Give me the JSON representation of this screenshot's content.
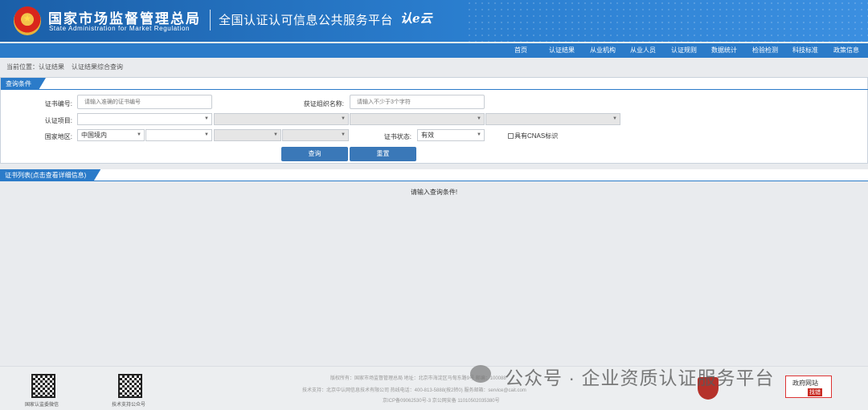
{
  "header": {
    "agency_cn": "国家市场监督管理总局",
    "agency_en": "State Administration  for  Market Regulation",
    "platform": "全国认证认可信息公共服务平台",
    "logo_text": "认e云"
  },
  "nav": [
    "首页",
    "认证结果",
    "从业机构",
    "从业人员",
    "认证规则",
    "数据统计",
    "检验检测",
    "科技标准",
    "政策信息"
  ],
  "breadcrumb": {
    "label": "当前位置：",
    "level1": "认证结果",
    "level2": "认证结果综合查询"
  },
  "query": {
    "section_title": "查询条件",
    "cert_no_label": "证书编号:",
    "cert_no_placeholder": "请输入准确的证书编号",
    "org_name_label": "获证组织名称:",
    "org_name_placeholder": "请输入不少于3个字符",
    "project_label": "认证项目:",
    "region_label": "国家地区:",
    "region_value": "中国境内",
    "status_label": "证书状态:",
    "status_value": "有效",
    "cnas_label": "具有CNAS标识",
    "search_button": "查询",
    "reset_button": "重置"
  },
  "list": {
    "section_title": "证书列表(点击查看详细信息)",
    "empty_message": "请输入查询条件!"
  },
  "footer": {
    "qr1_label": "国家认监委微信",
    "qr2_label": "技术支持公众号",
    "line1": "版权所有：国家市场监督管理总局    地址：北京市海淀区马甸东路9号    邮编：100088",
    "line2": "技术支持：北京中认网信息技术有限公司    热线电话：400-813-5888(按2转0)    服务邮箱：service@cait.com",
    "line3": "京ICP备09062530号-3    京公网安备 11010502035380号",
    "gov_box_line1": "政府网站",
    "gov_box_line2": "找错"
  },
  "watermark": "公众号 · 企业资质认证服务平台"
}
